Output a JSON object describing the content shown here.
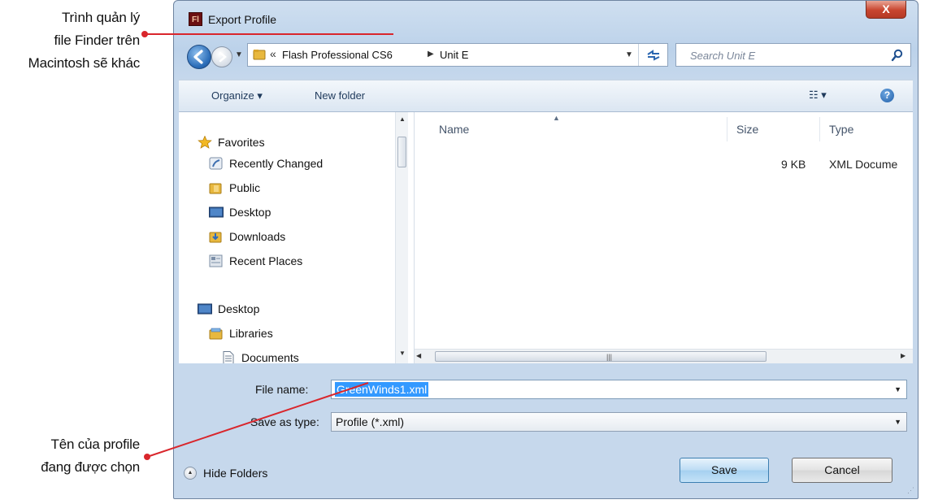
{
  "callouts": {
    "top": [
      "Trình quản lý",
      "file Finder trên",
      "Macintosh sẽ khác"
    ],
    "bottom": [
      "Tên của profile",
      "đang được chọn"
    ],
    "line_color": "#d9262c"
  },
  "window": {
    "title": "Export Profile",
    "app_icon_text": "Fl",
    "close_label": "X"
  },
  "address": {
    "chevron": "«",
    "crumbs": [
      "Flash Professional CS6",
      "Unit E"
    ],
    "search_placeholder": "Search Unit E"
  },
  "toolbar": {
    "organize": "Organize ▾",
    "new_folder": "New folder",
    "views": "☷ ▾",
    "help": "?"
  },
  "nav": {
    "items": [
      {
        "label": "Favorites",
        "icon": "star-icon"
      },
      {
        "label": "Recently Changed",
        "icon": "recent-icon"
      },
      {
        "label": "Public",
        "icon": "folder-icon"
      },
      {
        "label": "Desktop",
        "icon": "desktop-icon"
      },
      {
        "label": "Downloads",
        "icon": "downloads-icon"
      },
      {
        "label": "Recent Places",
        "icon": "recent-places-icon"
      },
      {
        "label": "Desktop",
        "icon": "desktop-icon"
      },
      {
        "label": "Libraries",
        "icon": "libraries-icon"
      },
      {
        "label": "Documents",
        "icon": "documents-icon"
      }
    ]
  },
  "files": {
    "columns": [
      "Name",
      "Size",
      "Type"
    ],
    "rows": [
      {
        "name": "",
        "size": "9 KB",
        "type": "XML Docume"
      }
    ]
  },
  "form": {
    "file_name_label": "File name:",
    "file_name_value": "GreenWinds1.xml",
    "type_label": "Save as type:",
    "type_value": "Profile (*.xml)"
  },
  "footer": {
    "hide_folders": "Hide Folders",
    "save": "Save",
    "cancel": "Cancel"
  },
  "colors": {
    "accent": "#3399ff",
    "window_chrome": "#c6d8ec"
  }
}
